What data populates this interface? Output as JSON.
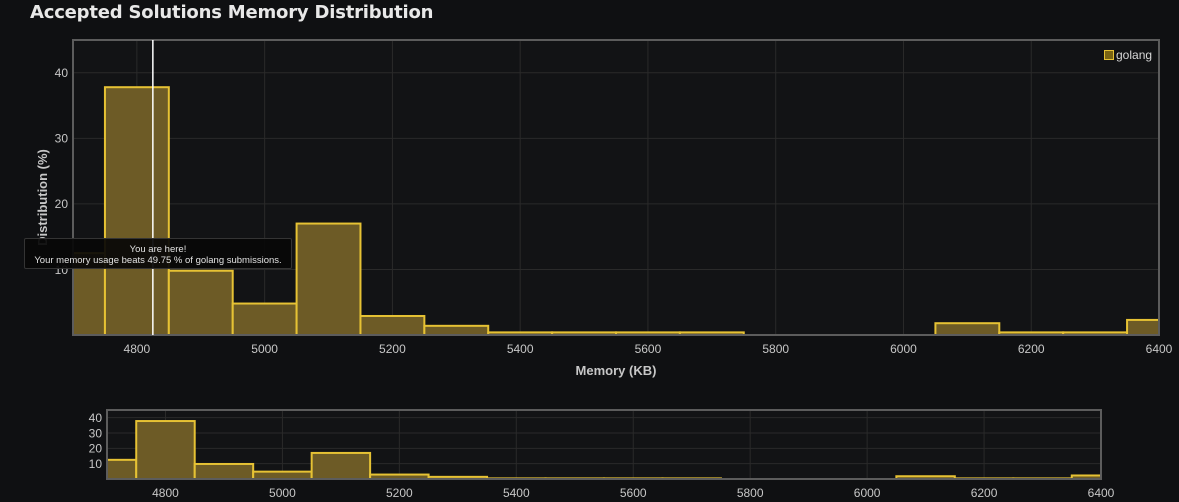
{
  "page": {
    "title": "Accepted Solutions Memory Distribution"
  },
  "tooltip": {
    "line1": "You are here!",
    "line2": "Your memory usage beats 49.75 % of golang submissions."
  },
  "legend": {
    "label": "golang"
  },
  "colors": {
    "background": "#0f1012",
    "bar_fill": "#6d5b26",
    "bar_stroke": "#e6c234",
    "marker": "#ffffff",
    "grid": "#2a2a2a",
    "axis_border": "#5c5c5c"
  },
  "chart_data": [
    {
      "type": "bar",
      "title": "Accepted Solutions Memory Distribution",
      "xlabel": "Memory (KB)",
      "ylabel": "Distribution (%)",
      "xlim": [
        4700,
        6400
      ],
      "ylim": [
        0,
        45
      ],
      "x_ticks": [
        4800,
        5000,
        5200,
        5400,
        5600,
        5800,
        6000,
        6200,
        6400
      ],
      "y_ticks": [
        10,
        20,
        30,
        40
      ],
      "bin_width": 100,
      "marker_x": 4825,
      "series": [
        {
          "name": "golang",
          "bins": [
            {
              "start": 4650,
              "value": 12.5
            },
            {
              "start": 4750,
              "value": 37.8
            },
            {
              "start": 4850,
              "value": 9.8
            },
            {
              "start": 4950,
              "value": 4.8
            },
            {
              "start": 5050,
              "value": 17.0
            },
            {
              "start": 5150,
              "value": 2.9
            },
            {
              "start": 5250,
              "value": 1.4
            },
            {
              "start": 5350,
              "value": 0.4
            },
            {
              "start": 5450,
              "value": 0.4
            },
            {
              "start": 5550,
              "value": 0.4
            },
            {
              "start": 5650,
              "value": 0.4
            },
            {
              "start": 6050,
              "value": 1.8
            },
            {
              "start": 6150,
              "value": 0.4
            },
            {
              "start": 6250,
              "value": 0.4
            },
            {
              "start": 6350,
              "value": 2.3
            }
          ]
        }
      ],
      "legend": "top-right",
      "grid": true
    },
    {
      "type": "bar",
      "title": "",
      "xlabel": "",
      "ylabel": "",
      "xlim": [
        4700,
        6400
      ],
      "ylim": [
        0,
        45
      ],
      "x_ticks": [
        4800,
        5000,
        5200,
        5400,
        5600,
        5800,
        6000,
        6200,
        6400
      ],
      "y_ticks": [
        10,
        20,
        30,
        40
      ],
      "bin_width": 100,
      "series": [
        {
          "bins": [
            {
              "start": 4650,
              "value": 12.5
            },
            {
              "start": 4750,
              "value": 37.8
            },
            {
              "start": 4850,
              "value": 9.8
            },
            {
              "start": 4950,
              "value": 4.8
            },
            {
              "start": 5050,
              "value": 17.0
            },
            {
              "start": 5150,
              "value": 2.9
            },
            {
              "start": 5250,
              "value": 1.4
            },
            {
              "start": 5350,
              "value": 0.4
            },
            {
              "start": 5450,
              "value": 0.4
            },
            {
              "start": 5550,
              "value": 0.4
            },
            {
              "start": 5650,
              "value": 0.4
            },
            {
              "start": 6050,
              "value": 1.8
            },
            {
              "start": 6150,
              "value": 0.4
            },
            {
              "start": 6250,
              "value": 0.4
            },
            {
              "start": 6350,
              "value": 2.3
            }
          ]
        }
      ],
      "grid": true
    }
  ]
}
